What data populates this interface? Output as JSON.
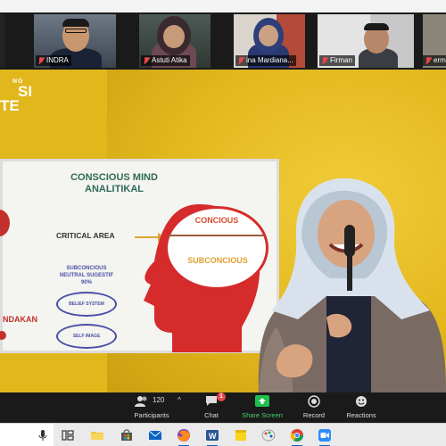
{
  "participants_gallery": [
    {
      "name": "INDRA",
      "muted": true
    },
    {
      "name": "Astuti Atika",
      "muted": true
    },
    {
      "name": "ina Mardiana...",
      "muted": true
    },
    {
      "name": "Firman",
      "muted": true
    },
    {
      "name": "ermei",
      "muted": true
    }
  ],
  "brand": {
    "line1": "NG",
    "line2": "SI",
    "line3": "TE"
  },
  "slide": {
    "title_line1": "CONSCIOUS MIND",
    "title_line2": "ANALITIKAL",
    "critical_area": "CRITICAL AREA",
    "concious": "CONCIOUS",
    "subconcious": "SUBCONCIOUS",
    "sub_neutral_line1": "SUBCONCIOUS",
    "sub_neutral_line2": "NEUTRAL SUGESTIF",
    "sub_neutral_line3": "90%",
    "oval1": "BELIEF SYSTEM",
    "oval2": "SELF IMAGE",
    "tindakan": "NDAKAN"
  },
  "toolbar": {
    "participants_label": "Participants",
    "participants_count": "120",
    "participants_caret": "^",
    "chat_label": "Chat",
    "chat_badge": "1",
    "share_label": "Share Screen",
    "record_label": "Record",
    "reactions_label": "Reactions"
  },
  "taskbar": {
    "icons": [
      "mic-icon",
      "task-view-icon",
      "file-explorer-icon",
      "store-icon",
      "mail-icon",
      "firefox-icon",
      "word-icon",
      "sticky-notes-icon",
      "paint-icon",
      "chrome-icon",
      "zoom-icon"
    ]
  },
  "colors": {
    "stage": "#e2b71c",
    "share_green": "#1fbf4e",
    "badge_red": "#e5484d",
    "taskbar_accent": "#0a64c2"
  }
}
